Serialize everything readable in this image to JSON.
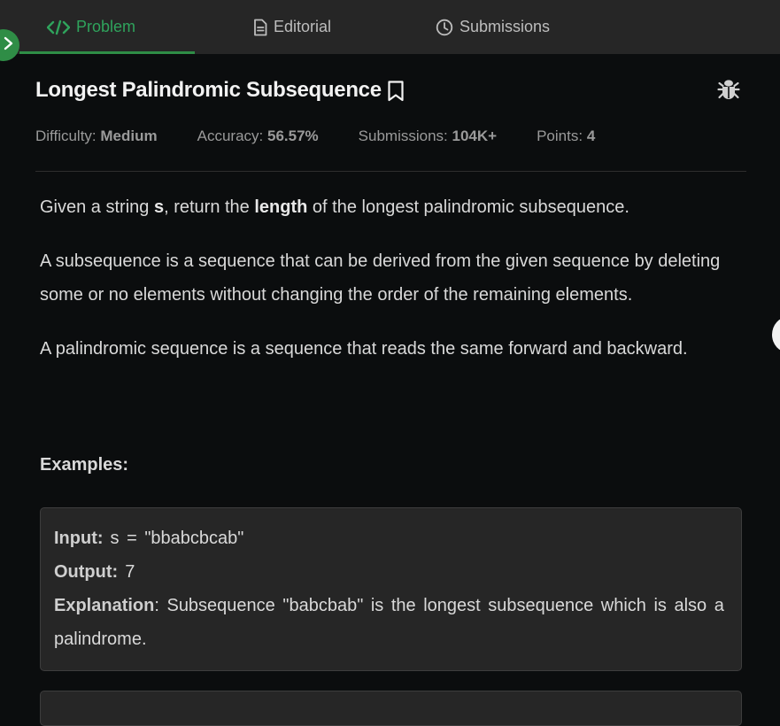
{
  "tabs": [
    {
      "label": "Problem",
      "icon": "code-icon",
      "active": true
    },
    {
      "label": "Editorial",
      "icon": "document-icon",
      "active": false
    },
    {
      "label": "Submissions",
      "icon": "clock-icon",
      "active": false
    }
  ],
  "problem": {
    "title": "Longest Palindromic Subsequence",
    "meta": {
      "difficulty_label": "Difficulty:",
      "difficulty": "Medium",
      "accuracy_label": "Accuracy:",
      "accuracy": "56.57%",
      "submissions_label": "Submissions:",
      "submissions": "104K+",
      "points_label": "Points:",
      "points": "4"
    },
    "paragraphs": {
      "p1_a": "Given a string ",
      "p1_b": "s",
      "p1_c": ", return the ",
      "p1_d": "length",
      "p1_e": " of the longest palindromic subsequence.",
      "p2": "A subsequence is a sequence that can be derived from the given sequence by deleting some or no elements without changing the order of the remaining elements.",
      "p3": "A palindromic sequence is a sequence that reads the same forward and backward."
    },
    "examples_heading": "Examples:",
    "example1": {
      "input_label": "Input:",
      "input_value": "s = \"bbabcbcab\"",
      "output_label": "Output:",
      "output_value": "7",
      "explanation_label": "Explanation",
      "explanation_value": ": Subsequence \"babcbab\" is the longest subsequence which is also a palindrome."
    }
  },
  "colors": {
    "accent": "#2f8d46",
    "active_tab_text": "#2fa35c",
    "background": "#0b0d0e",
    "tabbar": "#262626"
  }
}
